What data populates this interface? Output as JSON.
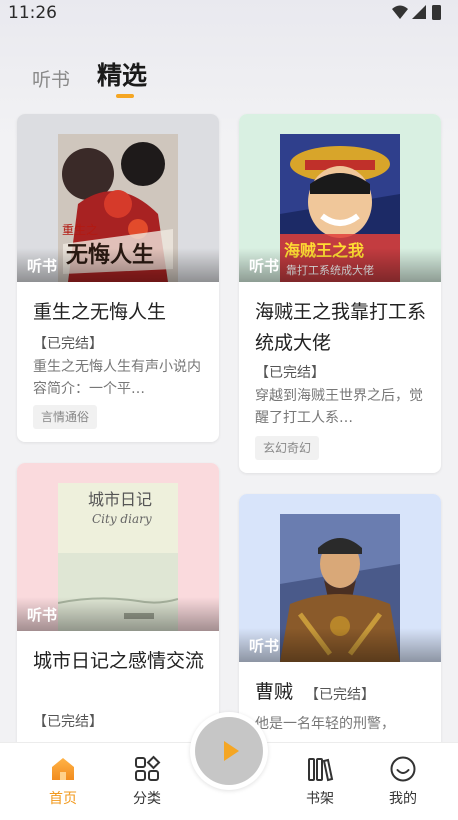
{
  "status_bar": {
    "time": "11:26"
  },
  "tabs": [
    {
      "label": "听书",
      "active": false
    },
    {
      "label": "精选",
      "active": true
    }
  ],
  "accent_color": "#f5a623",
  "books": [
    {
      "cover_tag": "听书",
      "title": "重生之无悔人生",
      "status": "【已完结】",
      "description": "重生之无悔人生有声小说内容简介：一个平…",
      "genre": "言情通俗"
    },
    {
      "cover_tag": "听书",
      "title": "海贼王之我靠打工系统成大佬",
      "status": "【已完结】",
      "description": "穿越到海贼王世界之后，觉醒了打工人系…",
      "genre": "玄幻奇幻"
    },
    {
      "cover_tag": "听书",
      "title": "城市日记之感情交流",
      "status": "【已完结】",
      "description": "",
      "genre": ""
    },
    {
      "cover_tag": "听书",
      "title": "曹贼",
      "status": "【已完结】",
      "description": "他是一名年轻的刑警，",
      "genre": ""
    }
  ],
  "bottom_nav": [
    {
      "label": "首页",
      "icon": "home-icon",
      "active": true
    },
    {
      "label": "分类",
      "icon": "category-icon",
      "active": false
    },
    {
      "label": "书架",
      "icon": "bookshelf-icon",
      "active": false
    },
    {
      "label": "我的",
      "icon": "profile-icon",
      "active": false
    }
  ]
}
